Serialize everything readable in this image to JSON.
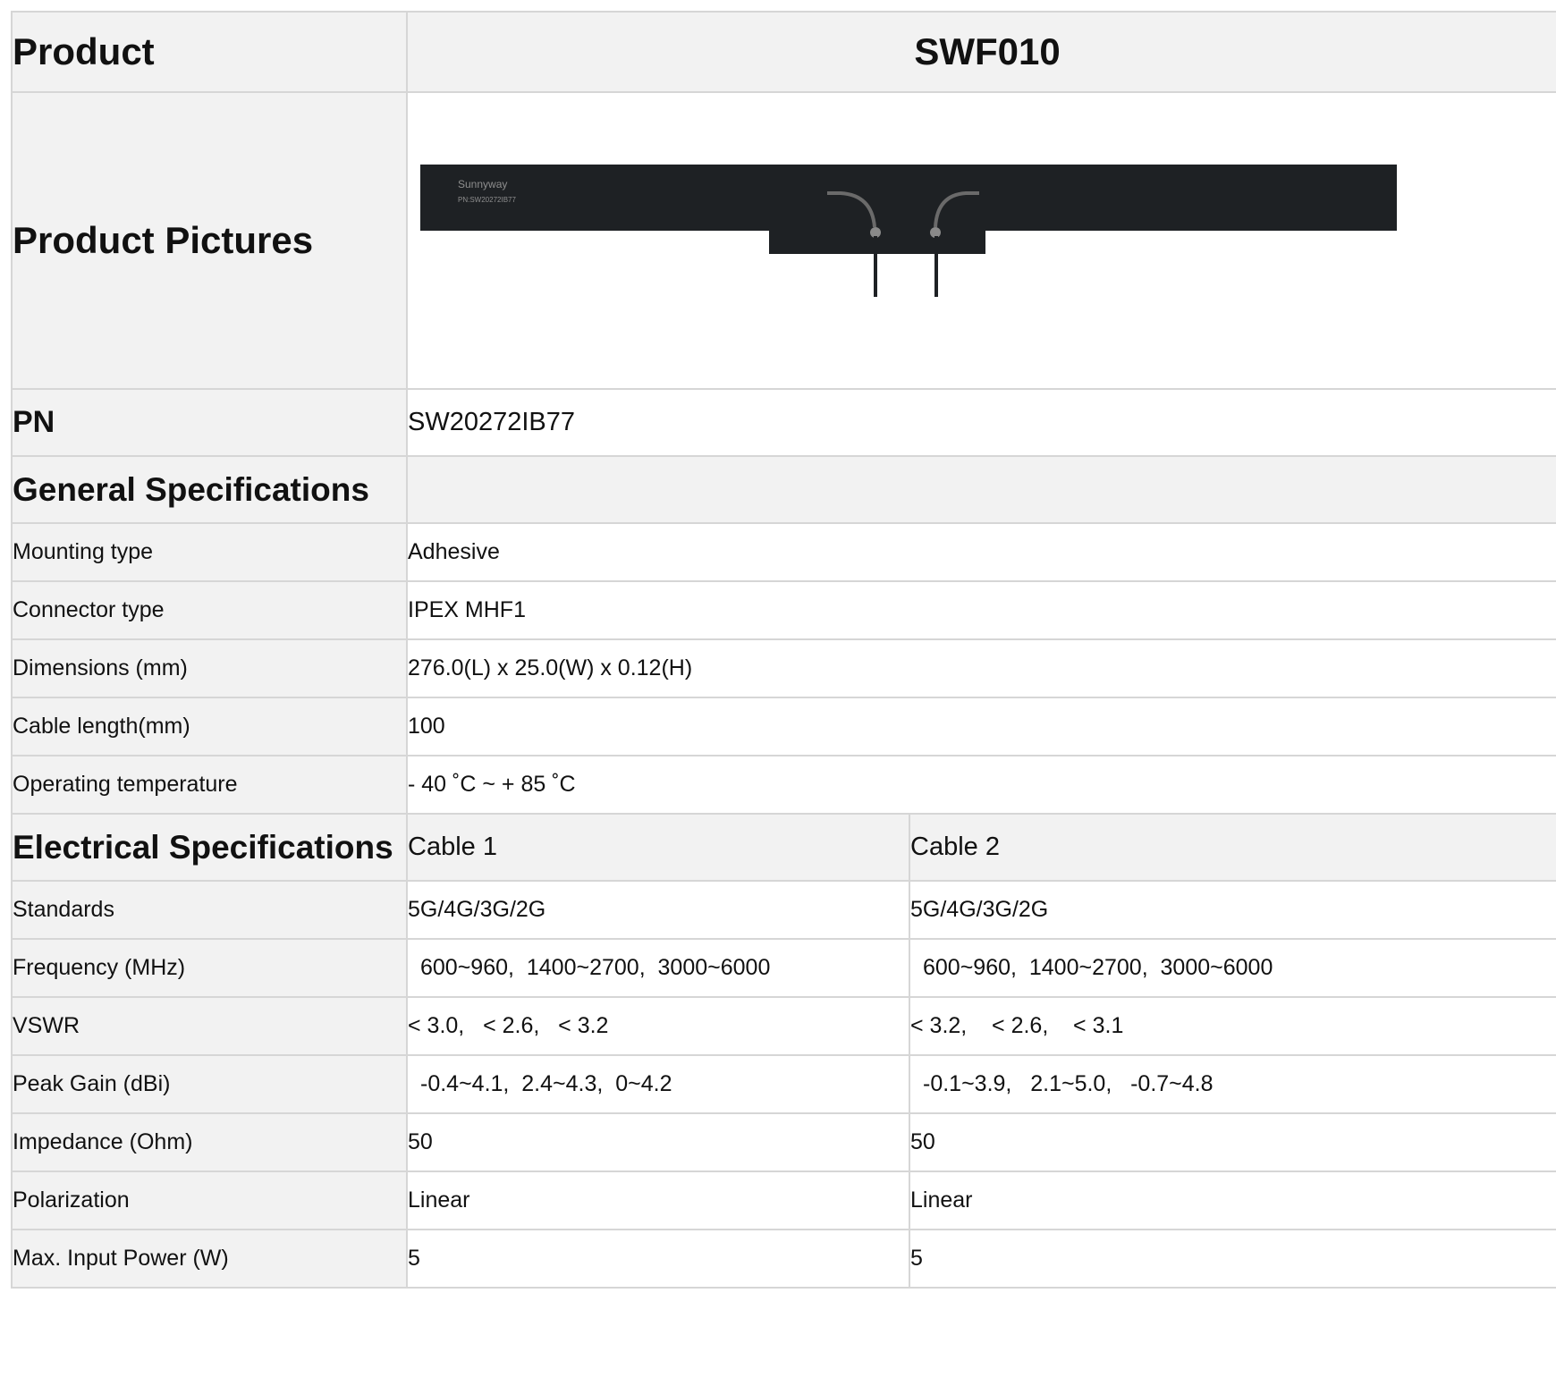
{
  "header": {
    "label": "Product",
    "value": "SWF010"
  },
  "pictures": {
    "label": "Product Pictures",
    "print_brand": "Sunnyway",
    "print_pn": "PN:SW20272IB77"
  },
  "pn": {
    "label": "PN",
    "value": "SW20272IB77"
  },
  "general": {
    "title": "General Specifications",
    "rows": [
      {
        "label": "Mounting type",
        "value": "Adhesive"
      },
      {
        "label": "Connector type",
        "value": "IPEX MHF1"
      },
      {
        "label": "Dimensions (mm)",
        "value": "276.0(L) x 25.0(W) x 0.12(H)"
      },
      {
        "label": "Cable length(mm)",
        "value": "100"
      },
      {
        "label": "Operating temperature",
        "value": "- 40 ˚C ~ + 85 ˚C"
      }
    ]
  },
  "electrical": {
    "title": "Electrical Specifications",
    "cable1": "Cable 1",
    "cable2": "Cable 2",
    "rows": [
      {
        "label": "Standards",
        "c1": "5G/4G/3G/2G",
        "c2": "5G/4G/3G/2G"
      },
      {
        "label": "Frequency (MHz)",
        "c1": "600~960,  1400~2700,  3000~6000",
        "c2": "600~960,  1400~2700,  3000~6000"
      },
      {
        "label": "VSWR",
        "c1": "< 3.0,   < 2.6,   < 3.2",
        "c2": "< 3.2,    < 2.6,    < 3.1"
      },
      {
        "label": "Peak Gain (dBi)",
        "c1": "-0.4~4.1,  2.4~4.3,  0~4.2",
        "c2": "-0.1~3.9,   2.1~5.0,   -0.7~4.8"
      },
      {
        "label": "Impedance (Ohm)",
        "c1": "50",
        "c2": "50"
      },
      {
        "label": "Polarization",
        "c1": "Linear",
        "c2": "Linear"
      },
      {
        "label": "Max. Input Power (W)",
        "c1": "5",
        "c2": "5"
      }
    ]
  },
  "colors": {
    "border": "#d6d6d6",
    "label_bg": "#f2f2f2",
    "antenna": "#1e2124"
  }
}
